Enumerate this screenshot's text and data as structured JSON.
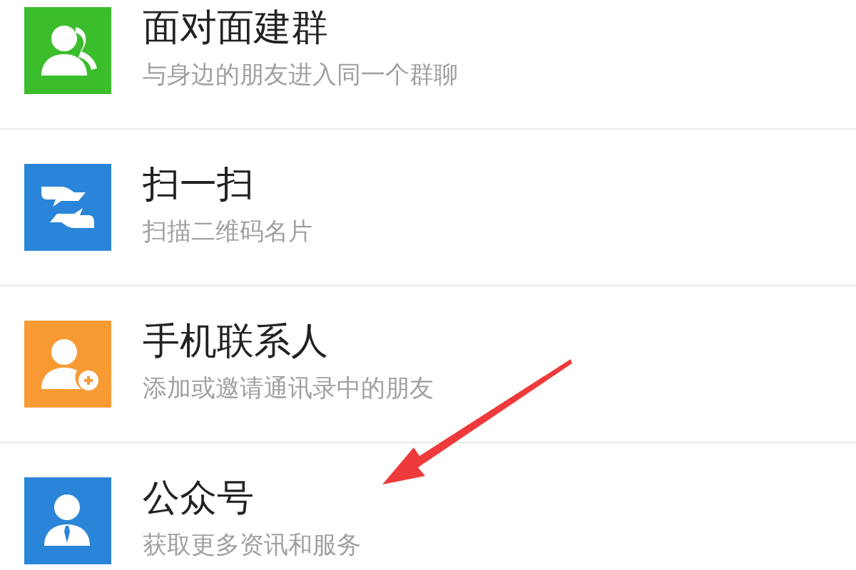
{
  "items": [
    {
      "kind": "group",
      "title": "面对面建群",
      "subtitle": "与身边的朋友进入同一个群聊"
    },
    {
      "kind": "scan",
      "title": "扫一扫",
      "subtitle": "扫描二维码名片"
    },
    {
      "kind": "contact",
      "title": "手机联系人",
      "subtitle": "添加或邀请通讯录中的朋友"
    },
    {
      "kind": "account",
      "title": "公众号",
      "subtitle": "获取更多资讯和服务"
    }
  ]
}
